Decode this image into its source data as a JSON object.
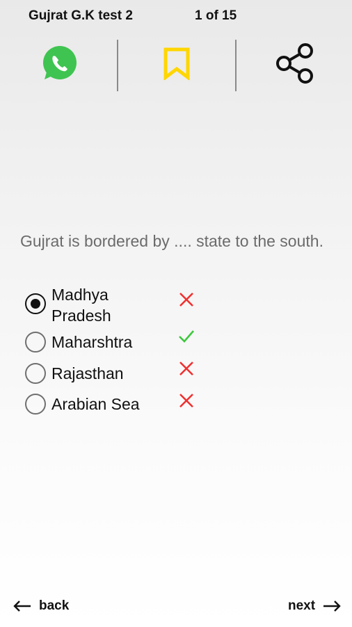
{
  "header": {
    "title": "Gujrat G.K test 2",
    "counter": "1 of 15"
  },
  "actions": [
    {
      "name": "whatsapp-icon",
      "color": "#3fc451"
    },
    {
      "name": "bookmark-icon",
      "color": "#ffd600"
    },
    {
      "name": "share-icon",
      "color": "#111111"
    }
  ],
  "question": {
    "text": "Gujrat is bordered by .... state to the south.",
    "options": [
      {
        "label": "Madhya Pradesh",
        "selected": true,
        "result": "wrong"
      },
      {
        "label": "Maharshtra",
        "selected": false,
        "result": "correct"
      },
      {
        "label": "Rajasthan",
        "selected": false,
        "result": "wrong"
      },
      {
        "label": "Arabian Sea",
        "selected": false,
        "result": "wrong"
      }
    ]
  },
  "nav": {
    "back_label": "back",
    "next_label": "next"
  },
  "colors": {
    "correct": "#3cc83c",
    "wrong": "#f03030"
  }
}
